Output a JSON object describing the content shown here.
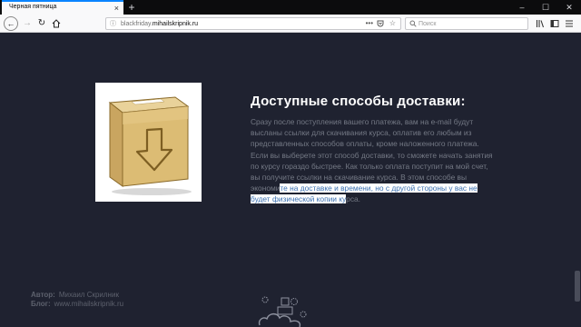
{
  "browser": {
    "tab_title": "Черная пятница",
    "tab_close": "×",
    "new_tab": "+",
    "url_host_dim": "blackfriday.",
    "url_host": "mihailskripnik.ru",
    "url_menu": "•••",
    "search_placeholder": "Поиск",
    "window_buttons": [
      "–",
      "☐",
      "✕"
    ]
  },
  "section": {
    "title": "Доступные способы доставки:",
    "body_plain": "Сразу после поступления вашего платежа, вам на e-mail будут высланы ссылки для скачивания курса, оплатив его любым из представленных способов оплаты, кроме наложенного платежа. Если вы выберете этот способ доставки, то сможете начать занятия по курсу гораздо быстрее. Как только оплата поступит на мой счет, вы получите ссылки на скачивание курса. В этом способе вы экономи",
    "body_highlight": "те на доставке и времени, но с другой стороны у вас не будет физической копии ку",
    "body_tail": "рса."
  },
  "footer": {
    "author_label": "Автор:",
    "author_value": "Михаил Скрилник",
    "blog_label": "Блог:",
    "blog_value": "www.mihailskripnik.ru"
  },
  "colors": {
    "page_bg": "#1f2230",
    "title": "#ffffff",
    "body_text": "#747985",
    "selection_bg": "#ffffff",
    "selection_text": "#3a6fb0",
    "accent_tab": "#0a84ff"
  },
  "icons": {
    "product": "box-download-icon",
    "footer_logo": "gears-cloud-icon"
  }
}
